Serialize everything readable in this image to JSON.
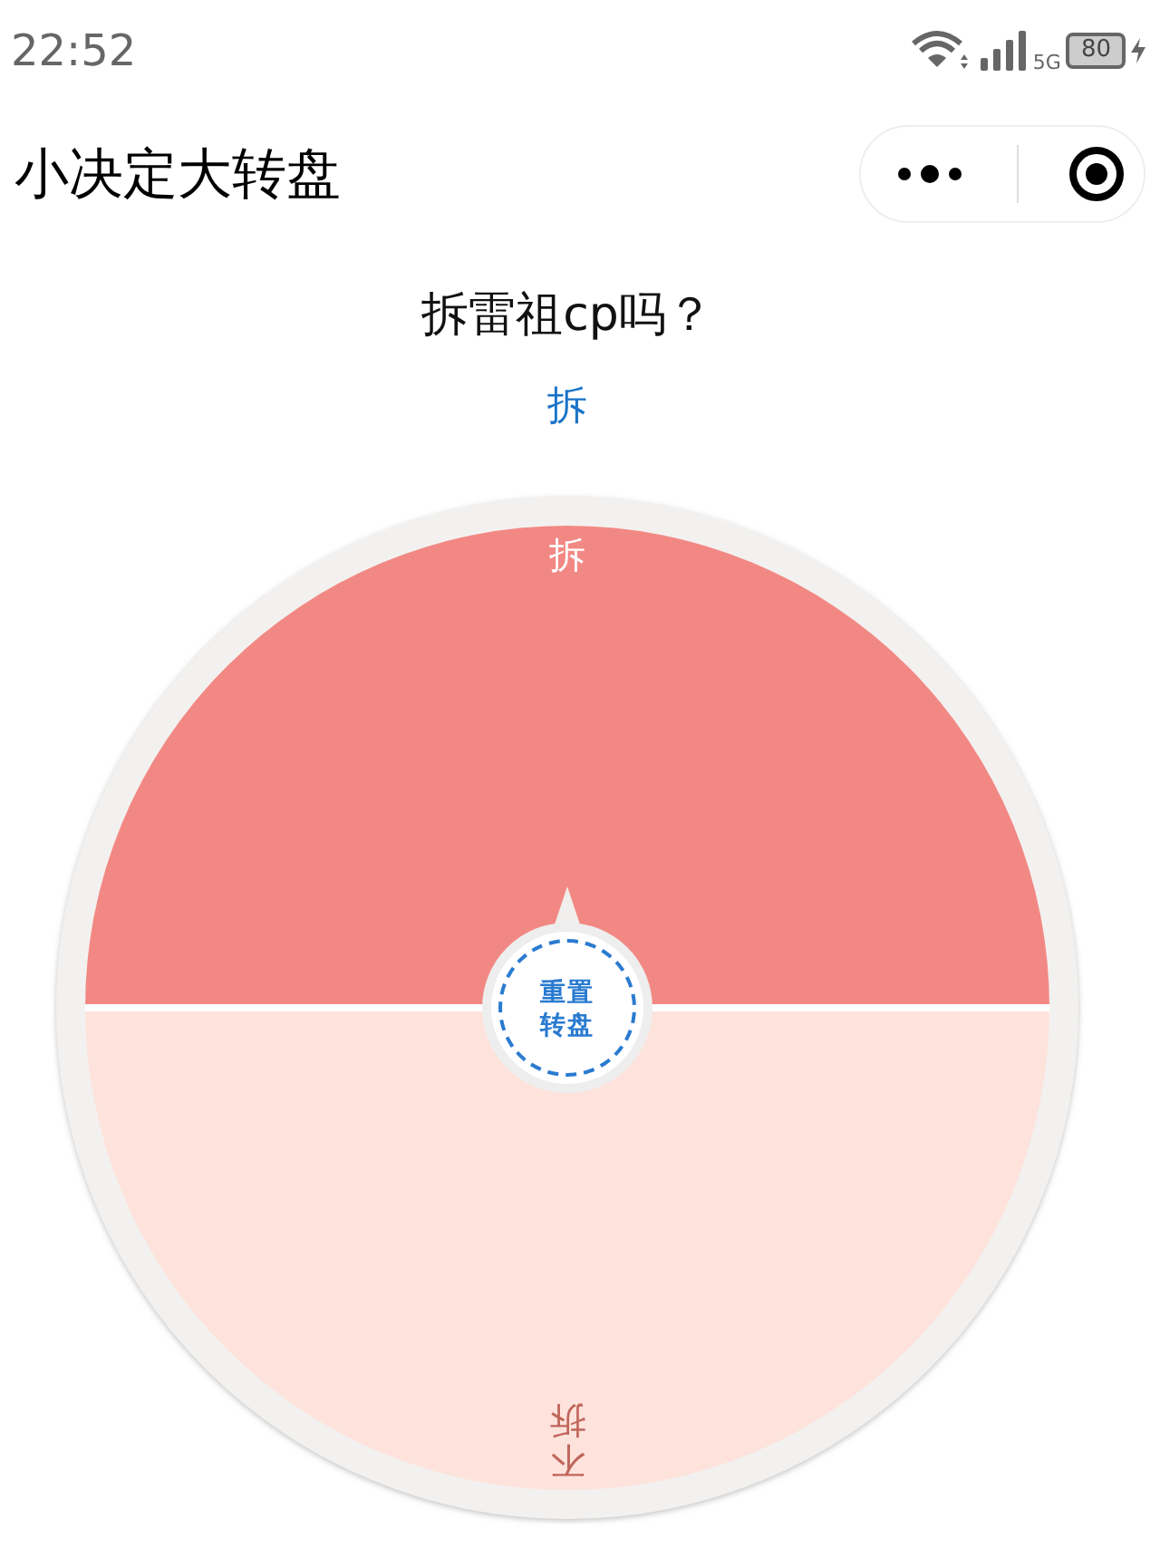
{
  "status_bar": {
    "time": "22:52",
    "network": "5G",
    "battery": "80"
  },
  "nav": {
    "title": "小决定大转盘"
  },
  "question": "拆雷祖cp吗？",
  "result": "拆",
  "wheel": {
    "segments": [
      {
        "label": "拆",
        "color": "#f28884"
      },
      {
        "label": "不拆",
        "color": "#fde3dc"
      }
    ],
    "center_button": "重置转盘"
  }
}
